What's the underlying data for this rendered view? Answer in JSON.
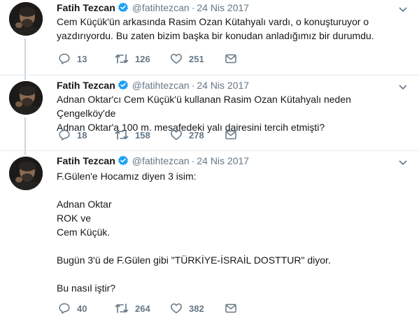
{
  "tweets": [
    {
      "name": "Fatih Tezcan",
      "handle": "@fatihtezcan",
      "dot": "·",
      "date": "24 Nis 2017",
      "lines": [
        "Cem Küçük'ün arkasında Rasim Ozan Kütahyalı vardı, o konuşturuyor o",
        "yazdırıyordu. Bu zaten bizim başka bir konudan anladığımız bir durumdu."
      ],
      "replies": "13",
      "retweets": "126",
      "likes": "251"
    },
    {
      "name": "Fatih Tezcan",
      "handle": "@fatihtezcan",
      "dot": "·",
      "date": "24 Nis 2017",
      "lines": [
        "Adnan Oktar'cı Cem Küçük'ü kullanan Rasim Ozan Kütahyalı neden Çengelköy'de",
        "Adnan Oktar'a 100 m. mesafedeki yalı dairesini tercih etmişti?"
      ],
      "replies": "18",
      "retweets": "158",
      "likes": "278"
    },
    {
      "name": "Fatih Tezcan",
      "handle": "@fatihtezcan",
      "dot": "·",
      "date": "24 Nis 2017",
      "lines": [
        "F.Gülen'e Hocamız diyen 3 isim:",
        "",
        "Adnan Oktar",
        "ROK ve",
        "Cem Küçük.",
        "",
        "Bugün 3'ü de F.Gülen gibi \"TÜRKİYE-İSRAİL DOSTTUR\" diyor.",
        "",
        "Bu nasıl iştir?"
      ],
      "replies": "40",
      "retweets": "264",
      "likes": "382"
    }
  ],
  "colors": {
    "accent": "#1da1f2",
    "muted": "#657786",
    "divider": "#e6ecf0",
    "thread_line": "#ccd6dd"
  },
  "icons": {
    "verified": "verified-badge-icon",
    "caret": "chevron-down-icon",
    "reply": "reply-icon",
    "retweet": "retweet-icon",
    "like": "heart-icon",
    "dm": "envelope-icon"
  }
}
